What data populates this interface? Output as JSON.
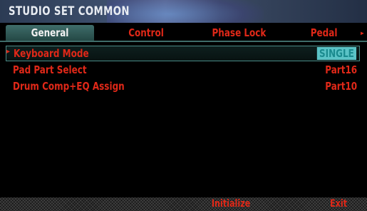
{
  "header": {
    "title": "STUDIO SET COMMON"
  },
  "tabs": [
    {
      "label": "General",
      "active": true
    },
    {
      "label": "Control",
      "active": false
    },
    {
      "label": "Phase Lock",
      "active": false
    },
    {
      "label": "Pedal",
      "active": false
    }
  ],
  "tab_more_indicator": "▸",
  "params": [
    {
      "label": "Keyboard Mode",
      "value": "SINGLE",
      "selected": true
    },
    {
      "label": "Pad Part Select",
      "value": "Part16",
      "selected": false
    },
    {
      "label": "Drum Comp+EQ Assign",
      "value": "Part10",
      "selected": false
    }
  ],
  "selected_caret": "▸",
  "footer": {
    "initialize_label": "Initialize",
    "exit_label": "Exit"
  },
  "colors": {
    "text": "#e02818",
    "accent": "#3f6d6a",
    "highlight": "#5bc3c6"
  }
}
